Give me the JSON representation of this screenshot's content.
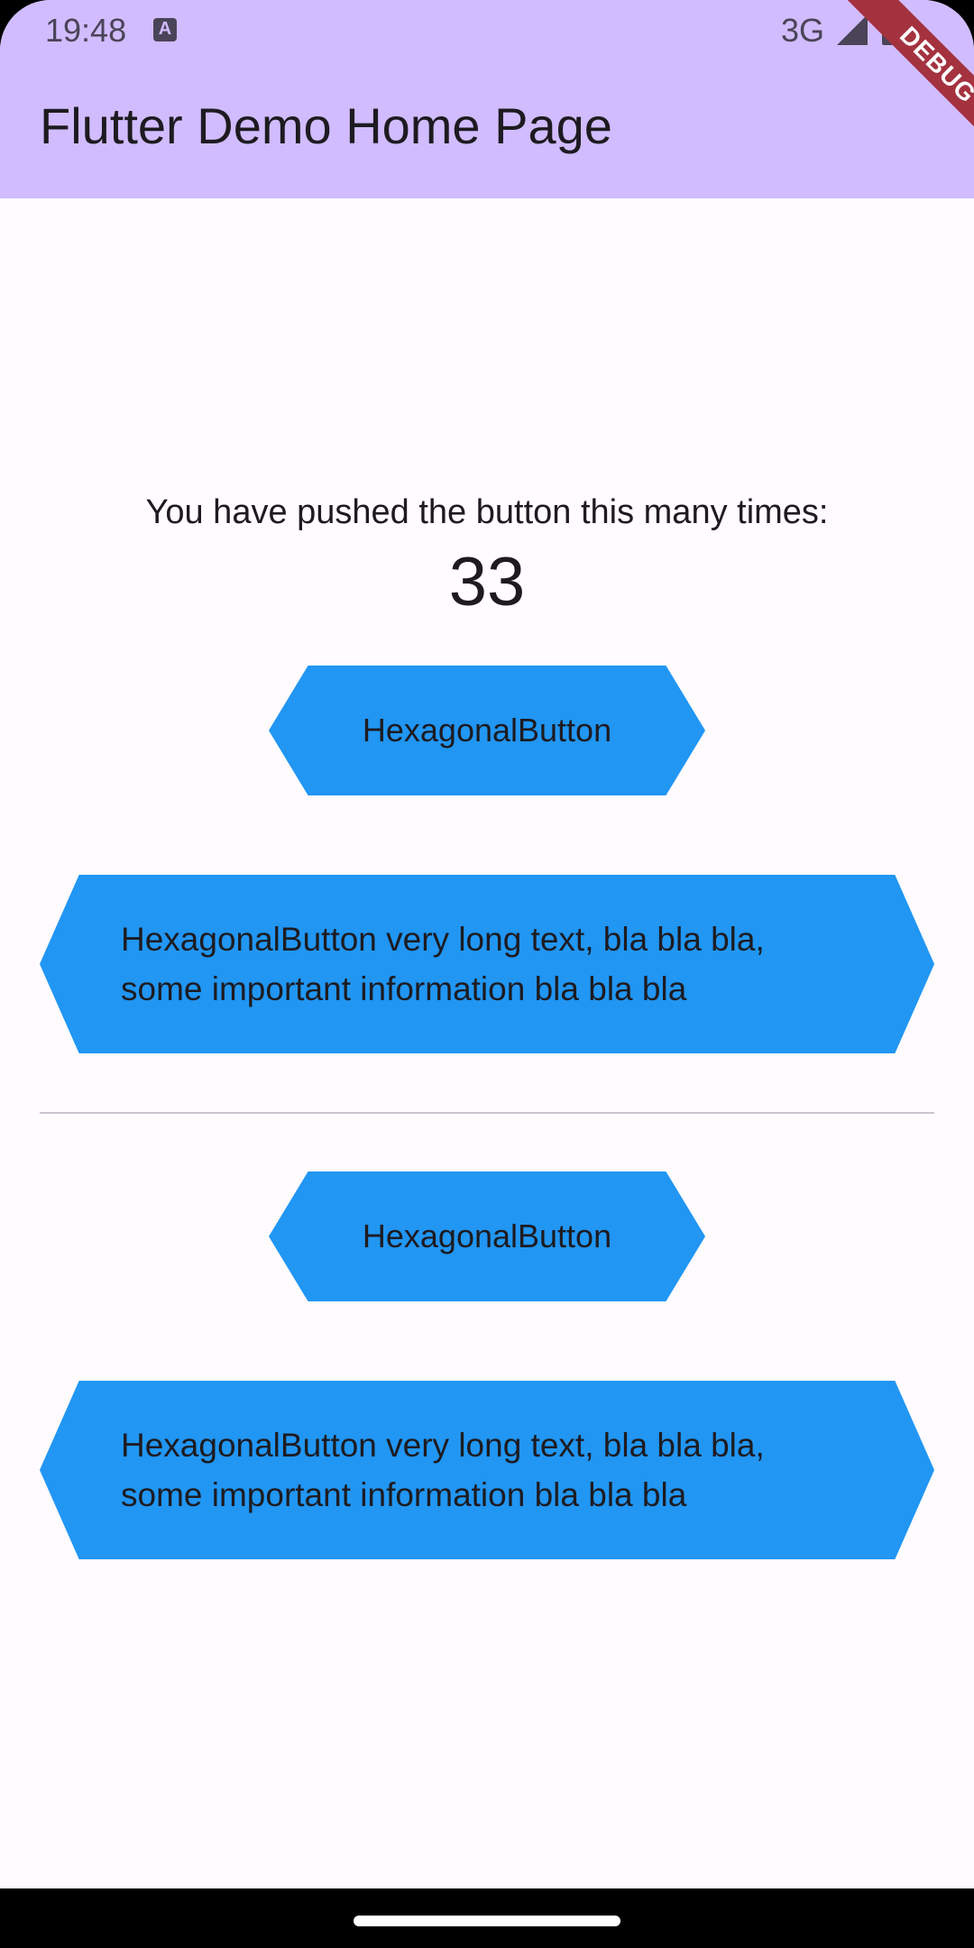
{
  "status_bar": {
    "time": "19:48",
    "network": "3G",
    "icons": [
      "accessibility-a-icon",
      "signal-icon",
      "battery-icon"
    ]
  },
  "app_bar": {
    "title": "Flutter Demo Home Page"
  },
  "debug_banner": {
    "label": "DEBUG"
  },
  "counter": {
    "label": "You have pushed the button this many times:",
    "value": "33"
  },
  "buttons": [
    {
      "label": "HexagonalButton"
    },
    {
      "label": "HexagonalButton  very long text, bla bla bla,\nsome important information bla bla bla"
    },
    {
      "label": "HexagonalButton"
    },
    {
      "label": "HexagonalButton  very long text, bla bla bla,\nsome important information bla bla bla"
    }
  ],
  "colors": {
    "app_bar": "#d1bcff",
    "button": "#2196f3",
    "background": "#fffbfe",
    "debug_ribbon": "#a4323f"
  }
}
